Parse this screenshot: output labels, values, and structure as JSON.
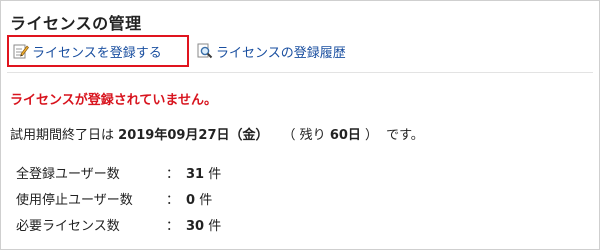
{
  "page_title": "ライセンスの管理",
  "actions": {
    "register_label": "ライセンスを登録する",
    "history_label": "ライセンスの登録履歴"
  },
  "warning": "ライセンスが登録されていません。",
  "trial": {
    "prefix": "試用期間終了日は",
    "end_date": "2019年09月27日（金）",
    "remaining_open": "（ 残り",
    "remaining_days": "60日",
    "remaining_close": "）",
    "suffix": "です。"
  },
  "stats": [
    {
      "label": "全登録ユーザー数",
      "colon": "：",
      "value": "31",
      "unit": "件"
    },
    {
      "label": "使用停止ユーザー数",
      "colon": "：",
      "value": "0",
      "unit": "件"
    },
    {
      "label": "必要ライセンス数",
      "colon": "：",
      "value": "30",
      "unit": "件"
    }
  ],
  "colors": {
    "link": "#1a4fa0",
    "warning": "#d8141e",
    "highlight_border": "#e0141e"
  },
  "icons": {
    "register": "edit-pencil-icon",
    "history": "magnifier-document-icon"
  }
}
